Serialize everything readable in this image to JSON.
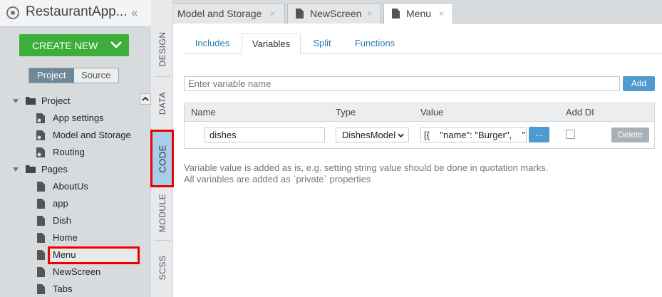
{
  "app": {
    "title": "RestaurantApp...",
    "collapse_icon": "double-chevron-left-icon"
  },
  "sidebar": {
    "create_button": "CREATE NEW",
    "toggle": {
      "project": "Project",
      "source": "Source",
      "selected": "Project"
    },
    "tree": [
      {
        "label": "Project",
        "type": "folder",
        "level": 0,
        "expanded": true
      },
      {
        "label": "App settings",
        "type": "settings-file",
        "level": 1
      },
      {
        "label": "Model and Storage",
        "type": "settings-file",
        "level": 1
      },
      {
        "label": "Routing",
        "type": "settings-file",
        "level": 1
      },
      {
        "label": "Pages",
        "type": "folder",
        "level": 0,
        "expanded": true
      },
      {
        "label": "AboutUs",
        "type": "page",
        "level": 1
      },
      {
        "label": "app",
        "type": "page",
        "level": 1
      },
      {
        "label": "Dish",
        "type": "page",
        "level": 1
      },
      {
        "label": "Home",
        "type": "page",
        "level": 1
      },
      {
        "label": "Menu",
        "type": "page",
        "level": 1,
        "selected": true
      },
      {
        "label": "NewScreen",
        "type": "page",
        "level": 1
      },
      {
        "label": "Tabs",
        "type": "page",
        "level": 1
      }
    ]
  },
  "vertical_tabs": [
    {
      "label": "DESIGN"
    },
    {
      "label": "DATA"
    },
    {
      "label": "CODE",
      "active": true
    },
    {
      "label": "MODULE"
    },
    {
      "label": "SCSS"
    }
  ],
  "file_tabs": [
    {
      "label": "Model and Storage",
      "close": "×"
    },
    {
      "label": "NewScreen",
      "close": "×"
    },
    {
      "label": "Menu",
      "close": "×",
      "active": true
    }
  ],
  "sub_tabs": [
    {
      "label": "Includes"
    },
    {
      "label": "Variables",
      "active": true
    },
    {
      "label": "Split"
    },
    {
      "label": "Functions"
    }
  ],
  "variable_input": {
    "placeholder": "Enter variable name",
    "value": ""
  },
  "add_button": "Add",
  "table": {
    "headers": {
      "name": "Name",
      "type": "Type",
      "value": "Value",
      "adddi": "Add DI"
    },
    "rows": [
      {
        "name": "dishes",
        "type": "DishesModel",
        "value": "[{    \"name\": \"Burger\",    \"",
        "more": "...",
        "add_di": false,
        "delete": "Delete"
      }
    ]
  },
  "notes": [
    "Variable value is added as is, e.g. setting string value should be done in quotation marks.",
    "All variables are added as `private` properties"
  ],
  "colors": {
    "accent_blue": "#4f9bd0",
    "create_green": "#3dae3a",
    "highlight_red": "#e00000"
  }
}
